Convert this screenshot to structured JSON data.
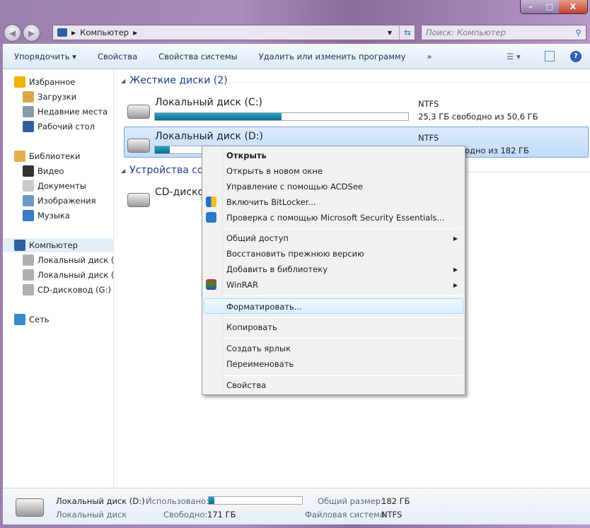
{
  "window": {
    "controls": {
      "minimize": "–",
      "maximize": "□",
      "close": "X"
    }
  },
  "address": {
    "segments": [
      "Компьютер"
    ],
    "search_placeholder": "Поиск: Компьютер"
  },
  "toolbar": {
    "organize": "Упорядочить ▾",
    "properties": "Свойства",
    "system_properties": "Свойства системы",
    "uninstall": "Удалить или изменить программу",
    "more": "»"
  },
  "sidebar": {
    "items": [
      {
        "label": "Избранное",
        "icon": "star-icon",
        "color": "#f0b400"
      },
      {
        "label": "Загрузки",
        "icon": "downloads-icon",
        "color": "#d8a94a"
      },
      {
        "label": "Недавние места",
        "icon": "recent-places-icon",
        "color": "#8a9aa8"
      },
      {
        "label": "Рабочий стол",
        "icon": "desktop-icon",
        "color": "#2f5f9f"
      },
      {
        "label": "Библиотеки",
        "icon": "libraries-icon",
        "color": "#e0b04a"
      },
      {
        "label": "Видео",
        "icon": "video-icon",
        "color": "#333"
      },
      {
        "label": "Документы",
        "icon": "documents-icon",
        "color": "#c9c9c9"
      },
      {
        "label": "Изображения",
        "icon": "pictures-icon",
        "color": "#6a9ac8"
      },
      {
        "label": "Музыка",
        "icon": "music-icon",
        "color": "#3a7ac8"
      },
      {
        "label": "Компьютер",
        "icon": "computer-icon",
        "color": "#2f5f9f"
      },
      {
        "label": "Локальный диск (C",
        "icon": "drive-icon",
        "color": "#b0b0b0"
      },
      {
        "label": "Локальный диск (D",
        "icon": "drive-icon",
        "color": "#b0b0b0"
      },
      {
        "label": "CD-дисковод (G:)",
        "icon": "cd-drive-icon",
        "color": "#b0b0b0"
      },
      {
        "label": "Сеть",
        "icon": "network-icon",
        "color": "#3a8ac8"
      }
    ]
  },
  "content": {
    "group_hdd": "Жесткие диски (2)",
    "group_removable": "Устройства со",
    "drives": [
      {
        "name": "Локальный диск (C:)",
        "fs": "NTFS",
        "free_text": "25,3 ГБ свободно из 50,6 ГБ",
        "used_fraction": 0.5
      },
      {
        "name": "Локальный диск (D:)",
        "fs": "NTFS",
        "free_text": "одно из 182 ГБ",
        "used_fraction": 0.06
      }
    ],
    "cd": "CD-диско"
  },
  "context_menu": {
    "items": [
      {
        "label": "Открыть",
        "bold": true
      },
      {
        "label": "Открыть в новом окне"
      },
      {
        "label": "Управление с помощью ACDSee"
      },
      {
        "label": "Включить BitLocker...",
        "icon": "shield-icon"
      },
      {
        "label": "Проверка с помощью Microsoft Security Essentials...",
        "icon": "security-essentials-icon"
      },
      {
        "label": "Общий доступ",
        "submenu": true
      },
      {
        "label": "Восстановить прежнюю версию"
      },
      {
        "label": "Добавить в библиотеку",
        "submenu": true
      },
      {
        "label": "WinRAR",
        "submenu": true,
        "icon": "winrar-icon"
      },
      {
        "label": "Форматировать...",
        "highlighted": true
      },
      {
        "label": "Копировать"
      },
      {
        "label": "Создать ярлык"
      },
      {
        "label": "Переименовать"
      },
      {
        "label": "Свойства"
      }
    ]
  },
  "status": {
    "name": "Локальный диск (D:)",
    "type": "Локальный диск",
    "used_label": "Использовано:",
    "used_fraction": 0.06,
    "free_label": "Свободно:",
    "free_value": "171 ГБ",
    "total_label": "Общий размер:",
    "total_value": "182 ГБ",
    "fs_label": "Файловая система:",
    "fs_value": "NTFS"
  }
}
